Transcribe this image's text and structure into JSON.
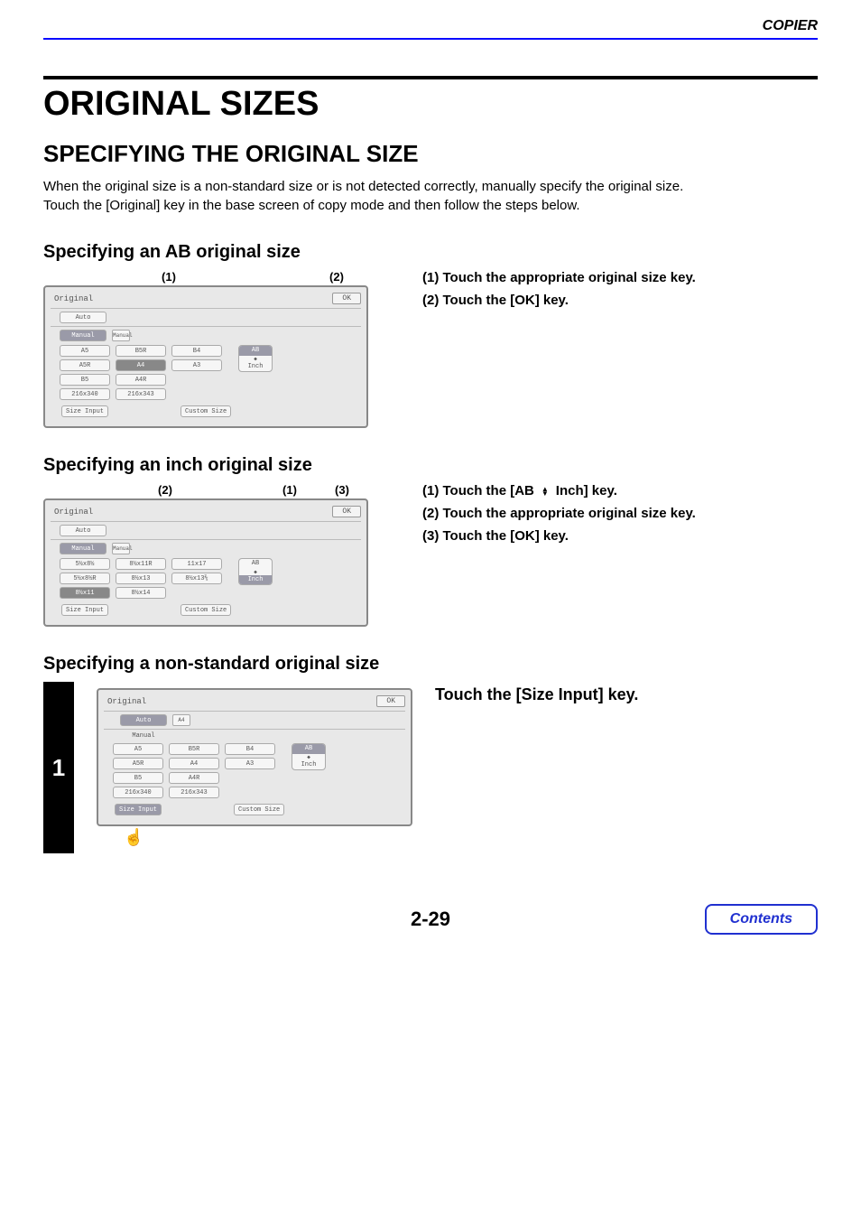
{
  "header": {
    "section": "COPIER"
  },
  "title": "ORIGINAL SIZES",
  "subtitle": "SPECIFYING THE ORIGINAL SIZE",
  "intro_line1": "When the original size is a non-standard size or is not detected correctly, manually specify the original size.",
  "intro_line2": "Touch the [Original] key in the base screen of copy mode and then follow the steps below.",
  "ab_section": {
    "heading": "Specifying an AB original size",
    "callout1": "(1)",
    "callout2": "(2)",
    "panel": {
      "title": "Original",
      "ok": "OK",
      "auto": "Auto",
      "manual": "Manual",
      "tab_label": "Manual",
      "sizes": [
        "A5",
        "B5R",
        "B4",
        "A5R",
        "A4",
        "A3",
        "B5",
        "A4R",
        "216x340",
        "216x343"
      ],
      "toggle_top": "AB",
      "toggle_bottom": "Inch",
      "size_input": "Size Input",
      "custom_size": "Custom Size"
    },
    "step1": "(1)  Touch the appropriate original size key.",
    "step2": "(2)  Touch the [OK] key."
  },
  "inch_section": {
    "heading": "Specifying an inch original size",
    "callout1": "(2)",
    "callout2": "(1)",
    "callout3": "(3)",
    "panel": {
      "title": "Original",
      "ok": "OK",
      "auto": "Auto",
      "manual": "Manual",
      "tab_label": "Manual",
      "sizes": [
        "5½x8½",
        "8½x11R",
        "11x17",
        "5½x8½R",
        "8½x13",
        "8½x13⅖",
        "8½x11",
        "8½x14"
      ],
      "toggle_top": "AB",
      "toggle_bottom": "Inch",
      "size_input": "Size Input",
      "custom_size": "Custom Size"
    },
    "step1_prefix": "(1)  Touch the [AB",
    "step1_suffix": "Inch] key.",
    "step2": "(2)  Touch the appropriate original size key.",
    "step3": "(3)  Touch the [OK] key."
  },
  "nonstd_section": {
    "heading": "Specifying a non-standard original size",
    "step_num": "1",
    "panel": {
      "title": "Original",
      "ok": "OK",
      "auto": "Auto",
      "auto_tag": "A4",
      "manual": "Manual",
      "sizes": [
        "A5",
        "B5R",
        "B4",
        "A5R",
        "A4",
        "A3",
        "B5",
        "A4R",
        "216x340",
        "216x343"
      ],
      "toggle_top": "AB",
      "toggle_bottom": "Inch",
      "size_input": "Size Input",
      "custom_size": "Custom Size"
    },
    "instruction": "Touch the [Size Input] key."
  },
  "footer": {
    "page": "2-29",
    "contents": "Contents"
  }
}
